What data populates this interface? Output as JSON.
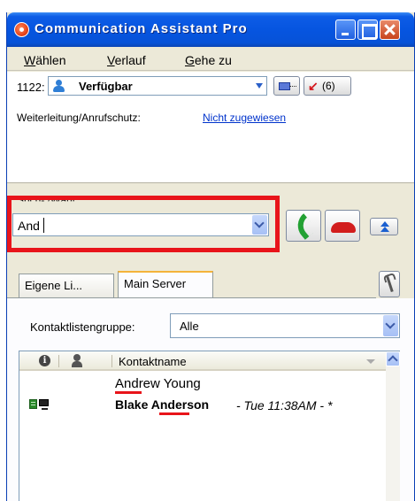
{
  "window": {
    "title": "Communication Assistant Pro"
  },
  "menu": {
    "items": [
      {
        "label": "Wählen",
        "mnemonic": "W",
        "rest": "ählen"
      },
      {
        "label": "Verlauf",
        "mnemonic": "V",
        "rest": "erlauf"
      },
      {
        "label": "Gehe zu",
        "mnemonic": "G",
        "rest": "ehe zu"
      }
    ]
  },
  "status": {
    "extension": "1122:",
    "presence": "Verfügbar",
    "missed_calls": "(6)",
    "forwarding_label": "Weiterleitung/Anrufschutz:",
    "forwarding_value": "Nicht zugewiesen"
  },
  "search": {
    "label": "Such- /Wähl",
    "value": "And"
  },
  "tabs": [
    {
      "label": "Eigene Li...",
      "active": false
    },
    {
      "label": "Main Server",
      "active": true
    }
  ],
  "contacts": {
    "group_label": "Kontaktlistengruppe:",
    "group_value": "Alle",
    "column_header": "Kontaktname",
    "rows": [
      {
        "name_prefix": "Andrew",
        "name_rest": " Young",
        "bold": false,
        "meta": ""
      },
      {
        "name_prefix": "Blake ",
        "name_match": "And",
        "name_rest": "erson",
        "bold": true,
        "meta": "- Tue 11:38AM -  *"
      }
    ]
  },
  "colors": {
    "title_bar": "#0655e0",
    "highlight": "#e8141a",
    "link": "#0033cc",
    "call_green": "#23a133",
    "hangup_red": "#d21d1d"
  },
  "icons": [
    "app-icon",
    "minimize-icon",
    "maximize-icon",
    "close-icon",
    "presence-person-icon",
    "voicemail-icon",
    "missed-call-icon",
    "call-icon",
    "hangup-icon",
    "expand-icon",
    "wrench-icon",
    "info-icon",
    "person-icon",
    "desk-phone-icon",
    "computer-icon"
  ]
}
